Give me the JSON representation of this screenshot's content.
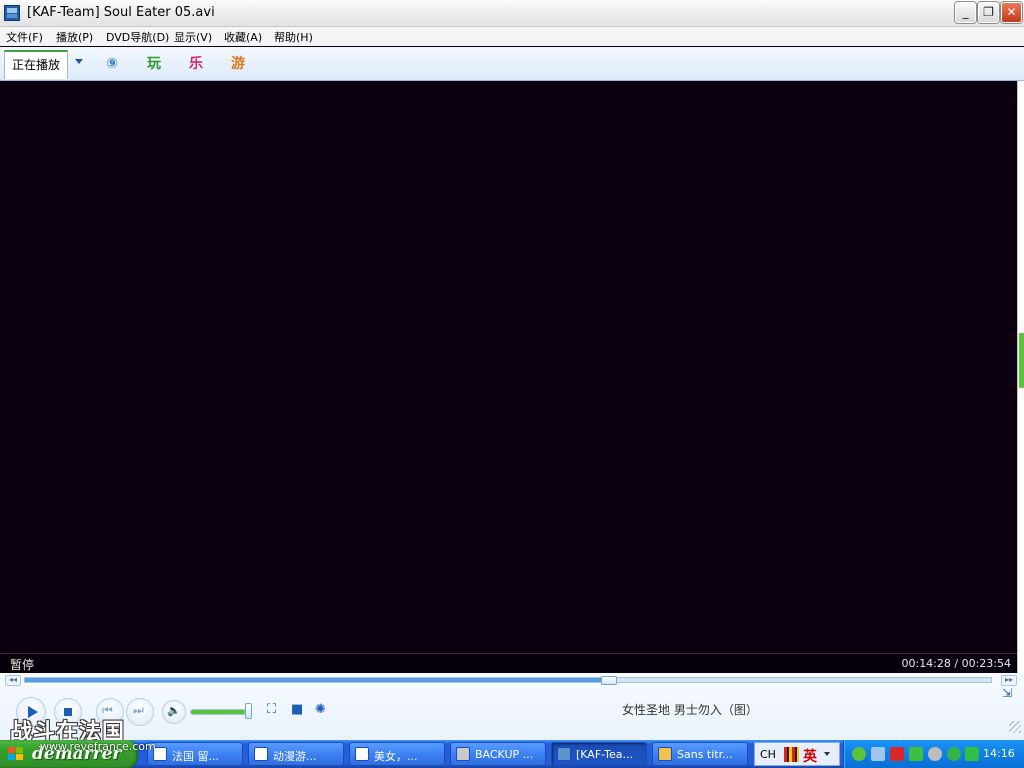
{
  "window": {
    "title": "[KAF-Team] Soul Eater 05.avi",
    "controls": {
      "minimize": "_",
      "maximize": "❐",
      "close": "✕"
    }
  },
  "menu": [
    {
      "label": "文件(F)"
    },
    {
      "label": "播放(P)"
    },
    {
      "label": "DVD导航(D)"
    },
    {
      "label": "显示(V)"
    },
    {
      "label": "收藏(A)"
    },
    {
      "label": "帮助(H)"
    }
  ],
  "tabs": {
    "now_playing": "正在播放",
    "icons": [
      {
        "name": "web-tv-icon",
        "glyph": "⑨"
      },
      {
        "name": "play-games-icon",
        "glyph": "玩"
      },
      {
        "name": "music-icon",
        "glyph": "乐"
      },
      {
        "name": "games-icon",
        "glyph": "游"
      }
    ]
  },
  "status": {
    "state": "暂停",
    "time": "00:14:28 / 00:23:54",
    "elapsed": "00:14:28",
    "duration": "00:23:54",
    "progress_fraction": 0.605
  },
  "controls": {
    "volume_fraction": 0.93,
    "promo_text": "女性圣地  男士勿入（图）"
  },
  "watermark": {
    "title": "战斗在法国",
    "url": "www.revefrance.com"
  },
  "taskbar": {
    "start_label": "démarrer",
    "items": [
      {
        "label": "法国 留...",
        "icon": "ie-icon",
        "active": false
      },
      {
        "label": "动漫游...",
        "icon": "ie-icon",
        "active": false
      },
      {
        "label": "美女，...",
        "icon": "ie-icon",
        "active": false
      },
      {
        "label": "BACKUP ...",
        "icon": "drive-icon",
        "active": false
      },
      {
        "label": "[KAF-Tea...",
        "icon": "player-icon",
        "active": true
      },
      {
        "label": "Sans titr...",
        "icon": "paint-icon",
        "active": false
      }
    ],
    "language": {
      "code": "CH",
      "mode": "英"
    },
    "tray_icons": [
      "messenger-icon",
      "network-icon",
      "pdf-icon",
      "network-connection-icon",
      "audio-icon",
      "update-icon",
      "security-icon"
    ],
    "clock": "14:16"
  },
  "colors": {
    "video_bg": "#0c0010",
    "taskbar_blue": "#245edb",
    "start_green": "#37a22d",
    "seek_fill": "#5a9be0",
    "volume_fill": "#57c23a"
  }
}
